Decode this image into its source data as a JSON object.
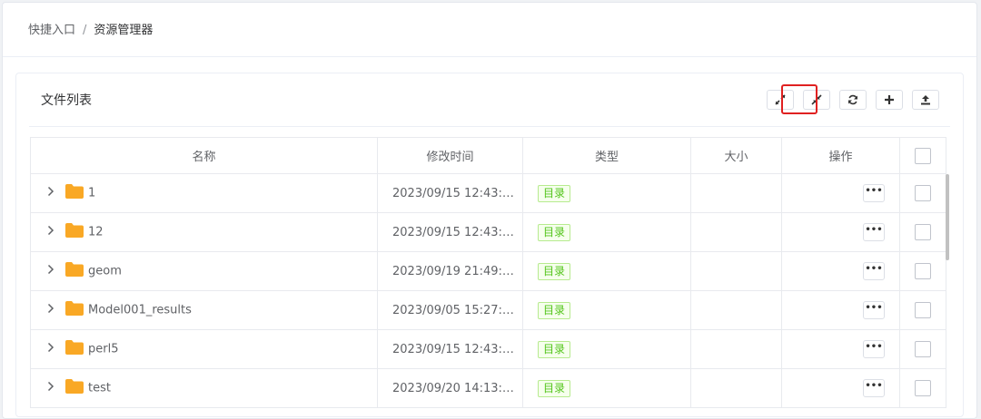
{
  "breadcrumb": {
    "root": "快捷入口",
    "separator": "/",
    "current": "资源管理器"
  },
  "panel": {
    "title": "文件列表",
    "toolbar": [
      {
        "icon": "expand-icon",
        "name": "expand-button"
      },
      {
        "icon": "collapse-icon",
        "name": "collapse-button"
      },
      {
        "icon": "refresh-icon",
        "name": "refresh-button"
      },
      {
        "icon": "plus-icon",
        "name": "add-button"
      },
      {
        "icon": "upload-icon",
        "name": "upload-button"
      }
    ]
  },
  "table": {
    "headers": {
      "name": "名称",
      "modified": "修改时间",
      "type": "类型",
      "size": "大小",
      "actions": "操作"
    },
    "rows": [
      {
        "name": "1",
        "modified": "2023/09/15 12:43:…",
        "type": "目录",
        "size": ""
      },
      {
        "name": "12",
        "modified": "2023/09/15 12:43:…",
        "type": "目录",
        "size": ""
      },
      {
        "name": "geom",
        "modified": "2023/09/19 21:49:…",
        "type": "目录",
        "size": ""
      },
      {
        "name": "Model001_results",
        "modified": "2023/09/05 15:27:…",
        "type": "目录",
        "size": ""
      },
      {
        "name": "perl5",
        "modified": "2023/09/15 12:43:…",
        "type": "目录",
        "size": ""
      },
      {
        "name": "test",
        "modified": "2023/09/20 14:13:…",
        "type": "目录",
        "size": ""
      }
    ],
    "more_label": "•••"
  },
  "colors": {
    "folder": "#f9a825",
    "tag_green": "#52c41a",
    "highlight": "#e02020"
  }
}
